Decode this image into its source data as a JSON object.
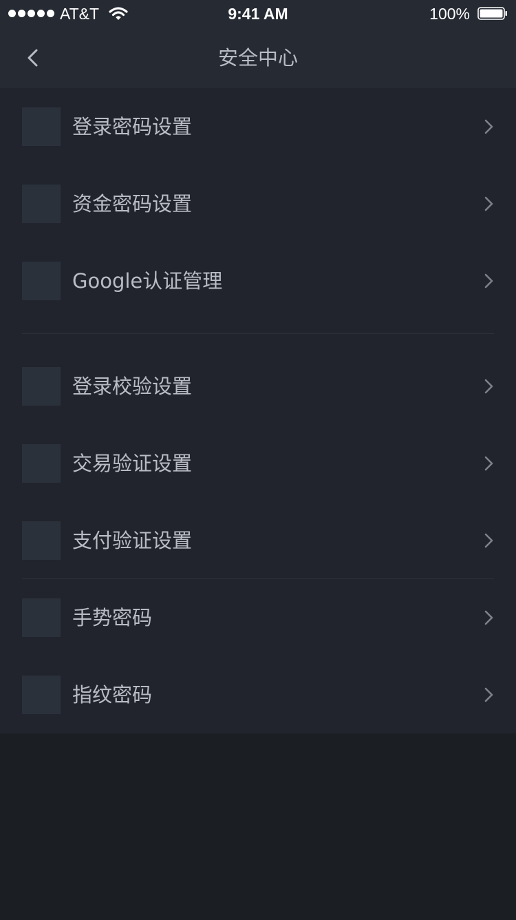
{
  "status_bar": {
    "carrier": "AT&T",
    "time": "9:41 AM",
    "battery": "100%",
    "signal_icon": "signal-dots-icon",
    "wifi_icon": "wifi-icon",
    "battery_icon": "battery-icon"
  },
  "nav": {
    "title": "安全中心",
    "back_icon": "chevron-left-icon"
  },
  "colors": {
    "background": "#1b1e22",
    "panel": "#21242c",
    "nav": "#262a33",
    "text": "#b9bcc4",
    "icon_placeholder": "#2b313b",
    "chevron": "#7d818a"
  },
  "groups": [
    {
      "items": [
        {
          "label": "登录密码设置",
          "icon": "placeholder-icon",
          "chevron": "chevron-right-icon"
        },
        {
          "label": "资金密码设置",
          "icon": "placeholder-icon",
          "chevron": "chevron-right-icon"
        },
        {
          "label": "Google认证管理",
          "icon": "placeholder-icon",
          "chevron": "chevron-right-icon"
        }
      ]
    },
    {
      "items": [
        {
          "label": "登录校验设置",
          "icon": "placeholder-icon",
          "chevron": "chevron-right-icon"
        },
        {
          "label": "交易验证设置",
          "icon": "placeholder-icon",
          "chevron": "chevron-right-icon"
        },
        {
          "label": "支付验证设置",
          "icon": "placeholder-icon",
          "chevron": "chevron-right-icon"
        }
      ]
    },
    {
      "items": [
        {
          "label": "手势密码",
          "icon": "placeholder-icon",
          "chevron": "chevron-right-icon"
        },
        {
          "label": "指纹密码",
          "icon": "placeholder-icon",
          "chevron": "chevron-right-icon"
        }
      ]
    }
  ]
}
